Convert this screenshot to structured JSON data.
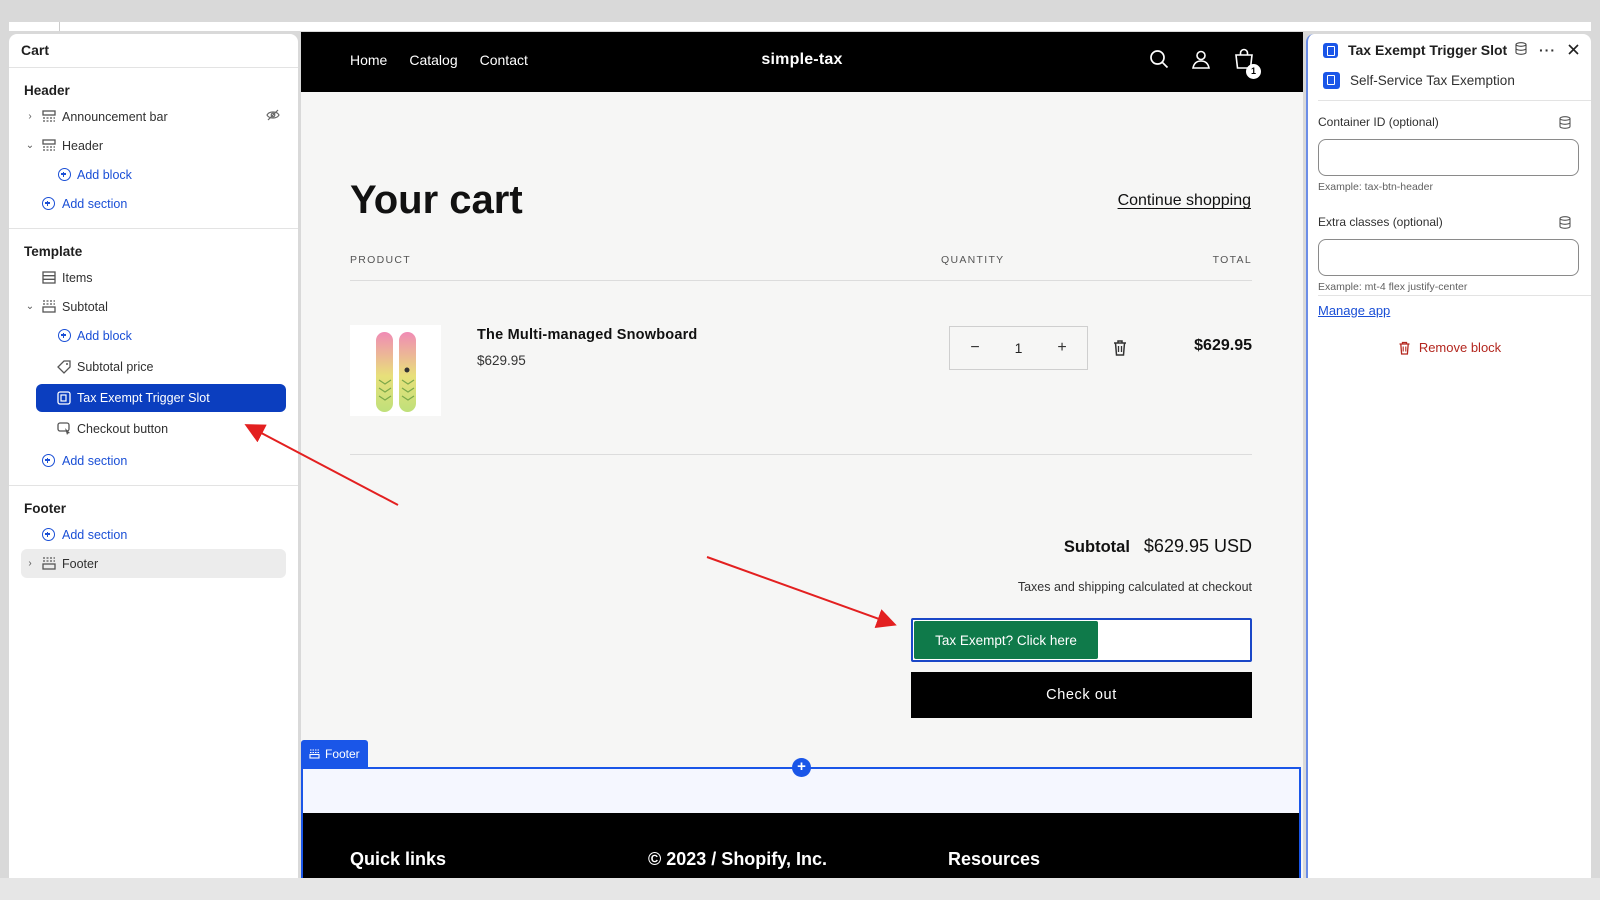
{
  "sidebar": {
    "title": "Cart",
    "header_group": {
      "title": "Header",
      "announcement": "Announcement bar",
      "header": "Header",
      "add_block": "Add block",
      "add_section": "Add section"
    },
    "template_group": {
      "title": "Template",
      "items": "Items",
      "subtotal": "Subtotal",
      "add_block": "Add block",
      "subtotal_price": "Subtotal price",
      "tax_slot": "Tax Exempt Trigger Slot",
      "checkout_button": "Checkout button",
      "add_section": "Add section"
    },
    "footer_group": {
      "title": "Footer",
      "add_section": "Add section",
      "footer": "Footer"
    }
  },
  "store": {
    "nav": [
      "Home",
      "Catalog",
      "Contact"
    ],
    "brand": "simple-tax",
    "cart_count": "1",
    "cart_title": "Your cart",
    "continue": "Continue shopping",
    "col_product": "PRODUCT",
    "col_quantity": "QUANTITY",
    "col_total": "TOTAL",
    "product_name": "The Multi-managed Snowboard",
    "product_price": "$629.95",
    "qty_minus": "−",
    "qty_value": "1",
    "qty_plus": "+",
    "line_total": "$629.95",
    "subtotal_label": "Subtotal",
    "subtotal_value": "$629.95 USD",
    "tax_note": "Taxes and shipping calculated at checkout",
    "tax_button": "Tax Exempt? Click here",
    "checkout": "Check out",
    "footer_tag": "Footer",
    "footer_cols": [
      "Quick links",
      "© 2023 / Shopify, Inc.",
      "Resources"
    ]
  },
  "panel": {
    "title": "Tax Exempt Trigger Slot",
    "subtitle": "Self-Service Tax Exemption",
    "container_label": "Container ID (optional)",
    "container_value": "",
    "container_help": "Example: tax-btn-header",
    "classes_label": "Extra classes (optional)",
    "classes_value": "",
    "classes_help": "Example: mt-4 flex justify-center",
    "manage": "Manage app",
    "remove": "Remove block"
  },
  "colors": {
    "selected": "#0b3ebf",
    "link": "#1a4fd6",
    "tax_button": "#0f7a4a",
    "danger": "#b3261e",
    "annotation_arrow": "#e32020"
  }
}
